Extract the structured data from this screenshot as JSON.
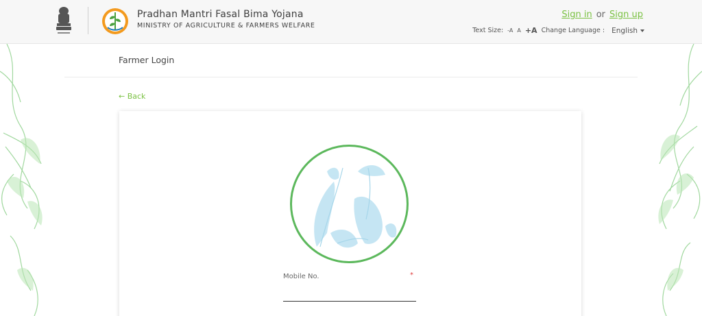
{
  "header": {
    "title": "Pradhan Mantri Fasal Bima Yojana",
    "subtitle": "MINISTRY OF AGRICULTURE & FARMERS WELFARE",
    "sign_in": "Sign in",
    "or": "or",
    "sign_up": "Sign up",
    "text_size_label": "Text Size:",
    "text_size_decrease": "-A",
    "text_size_normal": "A",
    "text_size_increase": "+A",
    "change_language_label": "Change Language :",
    "language": "English"
  },
  "page": {
    "title": "Farmer Login",
    "back": "← Back"
  },
  "form": {
    "mobile_label": "Mobile No.",
    "required_mark": "*",
    "mobile_value": ""
  },
  "colors": {
    "accent": "#7ac142",
    "circle_border": "#5cb85c",
    "illustration": "#bfe3f2",
    "side_leaves": "#8fd18c"
  },
  "icons": [
    "national-emblem-icon",
    "pmfby-logo-icon",
    "caret-down-icon",
    "leaf-pattern-icon"
  ]
}
